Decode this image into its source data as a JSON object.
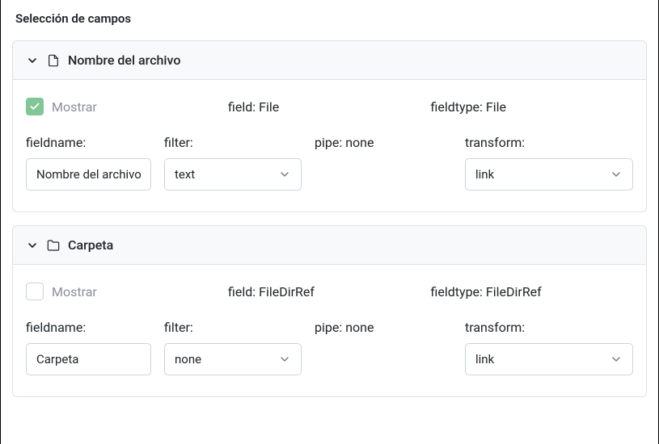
{
  "page_title": "Selección de campos",
  "labels": {
    "mostrar": "Mostrar",
    "field_prefix": "field: ",
    "fieldtype_prefix": "fieldtype: ",
    "fieldname": "fieldname:",
    "filter": "filter:",
    "pipe": "pipe: ",
    "transform": "transform:"
  },
  "fields": [
    {
      "title": "Nombre del archivo",
      "icon": "file",
      "mostrar_checked": true,
      "field": "File",
      "fieldtype": "File",
      "fieldname": "Nombre del archivo",
      "filter": "text",
      "pipe": "none",
      "transform": "link"
    },
    {
      "title": "Carpeta",
      "icon": "folder",
      "mostrar_checked": false,
      "field": "FileDirRef",
      "fieldtype": "FileDirRef",
      "fieldname": "Carpeta",
      "filter": "none",
      "pipe": "none",
      "transform": "link"
    }
  ]
}
